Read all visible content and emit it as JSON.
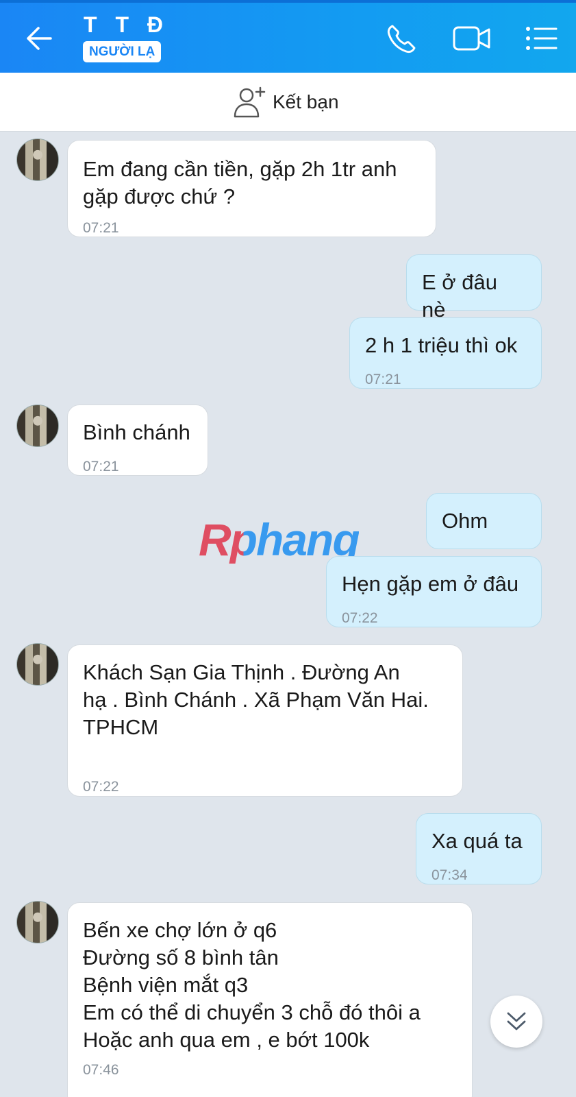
{
  "header": {
    "title": "T T Đ",
    "badge": "NGƯỜI LẠ",
    "icons": [
      "back-arrow-icon",
      "phone-icon",
      "video-camera-icon",
      "menu-list-icon"
    ],
    "gradient": [
      "#1a86f5",
      "#12a7ee"
    ]
  },
  "friend_bar": {
    "label": "Kết bạn",
    "icon": "add-friend-icon"
  },
  "messages": [
    {
      "from": "them",
      "text": "Em đang cần tiền, gặp 2h 1tr anh\ngặp được chứ ?",
      "time": "07:21"
    },
    {
      "from": "me",
      "text": "E ở đâu nè",
      "time": ""
    },
    {
      "from": "me",
      "text": "2 h 1 triệu thì ok",
      "time": "07:21"
    },
    {
      "from": "them",
      "text": "Bình chánh",
      "time": "07:21"
    },
    {
      "from": "me",
      "text": "Ohm",
      "time": ""
    },
    {
      "from": "me",
      "text": "Hẹn gặp em ở đâu",
      "time": "07:22"
    },
    {
      "from": "them",
      "text": "Khách Sạn Gia Thịnh  . Đường An\nhạ . Bình Chánh . Xã Phạm Văn Hai.\nTPHCM",
      "time": "07:22"
    },
    {
      "from": "me",
      "text": "Xa quá ta",
      "time": "07:34"
    },
    {
      "from": "them",
      "text": "Bến xe chợ lớn ở q6\nĐường số 8 bình tân\nBệnh viện mắt q3\nEm có thể di chuyển 3 chỗ đó thôi a\nHoặc anh qua em , e bớt 100k",
      "time": "07:46"
    }
  ],
  "watermark": "Rphang",
  "colors": {
    "incoming_bubble": "#ffffff",
    "outgoing_bubble": "#d4f0fd",
    "chat_background": "#dfe5ec",
    "timestamp": "#8a939c"
  }
}
